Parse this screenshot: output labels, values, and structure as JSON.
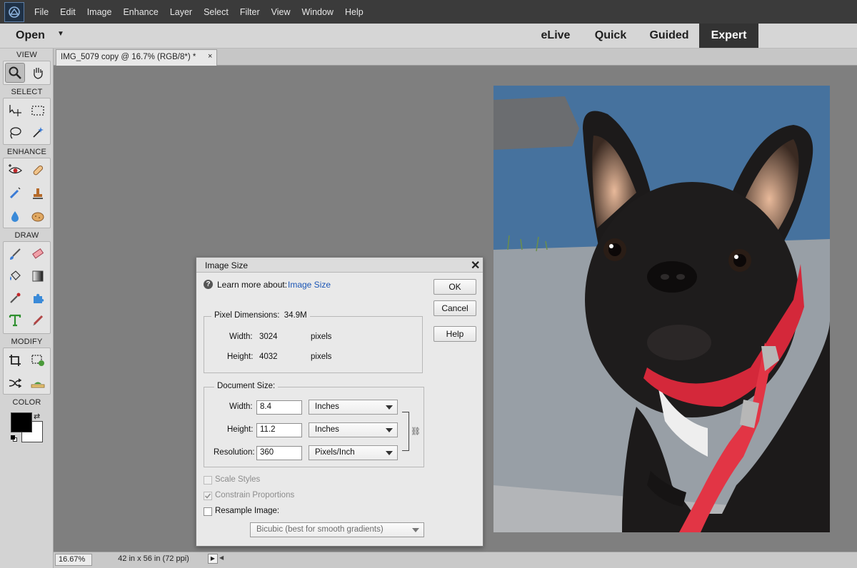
{
  "menubar": {
    "items": [
      "File",
      "Edit",
      "Image",
      "Enhance",
      "Layer",
      "Select",
      "Filter",
      "View",
      "Window",
      "Help"
    ]
  },
  "modebar": {
    "open_label": "Open",
    "tabs": [
      "eLive",
      "Quick",
      "Guided",
      "Expert"
    ],
    "active_tab": "Expert"
  },
  "toolbox": {
    "sections": [
      "VIEW",
      "SELECT",
      "ENHANCE",
      "DRAW",
      "MODIFY",
      "COLOR"
    ],
    "tools": {
      "view": [
        "zoom-tool",
        "hand-tool"
      ],
      "select": [
        "move-tool",
        "rectangular-marquee-tool",
        "lasso-tool",
        "quick-selection-tool"
      ],
      "enhance": [
        "red-eye-tool",
        "spot-healing-brush-tool",
        "smart-brush-tool",
        "clone-stamp-tool",
        "blur-tool",
        "sponge-tool"
      ],
      "draw": [
        "brush-tool",
        "eraser-tool",
        "paint-bucket-tool",
        "gradient-tool",
        "eyedropper-tool",
        "custom-shape-tool",
        "type-tool",
        "pencil-tool"
      ],
      "modify": [
        "crop-tool",
        "recompose-tool",
        "content-aware-move-tool",
        "straighten-tool"
      ]
    },
    "foreground_color": "#000000",
    "background_color": "#ffffff"
  },
  "document": {
    "tab_title": "IMG_5079 copy @ 16.7% (RGB/8*) *",
    "close_glyph": "×"
  },
  "statusbar": {
    "zoom": "16.67%",
    "doc_info": "42 in x 56 in (72 ppi)"
  },
  "dialog": {
    "title": "Image Size",
    "learn_more": "Learn more about:",
    "learn_link": "Image Size",
    "buttons": {
      "ok": "OK",
      "cancel": "Cancel",
      "help": "Help"
    },
    "pixel_dimensions": {
      "label": "Pixel Dimensions:",
      "size": "34.9M",
      "width_label": "Width:",
      "width_value": "3024",
      "width_unit": "pixels",
      "height_label": "Height:",
      "height_value": "4032",
      "height_unit": "pixels"
    },
    "document_size": {
      "label": "Document Size:",
      "width_label": "Width:",
      "width_value": "8.4",
      "width_unit": "Inches",
      "height_label": "Height:",
      "height_value": "11.2",
      "height_unit": "Inches",
      "resolution_label": "Resolution:",
      "resolution_value": "360",
      "resolution_unit": "Pixels/Inch"
    },
    "options": {
      "scale_styles": {
        "label": "Scale Styles",
        "checked": false,
        "enabled": false
      },
      "constrain_proportions": {
        "label": "Constrain Proportions",
        "checked": true,
        "enabled": false
      },
      "resample_image": {
        "label": "Resample Image:",
        "checked": false,
        "enabled": true
      }
    },
    "resample_method": "Bicubic (best for smooth gradients)"
  }
}
